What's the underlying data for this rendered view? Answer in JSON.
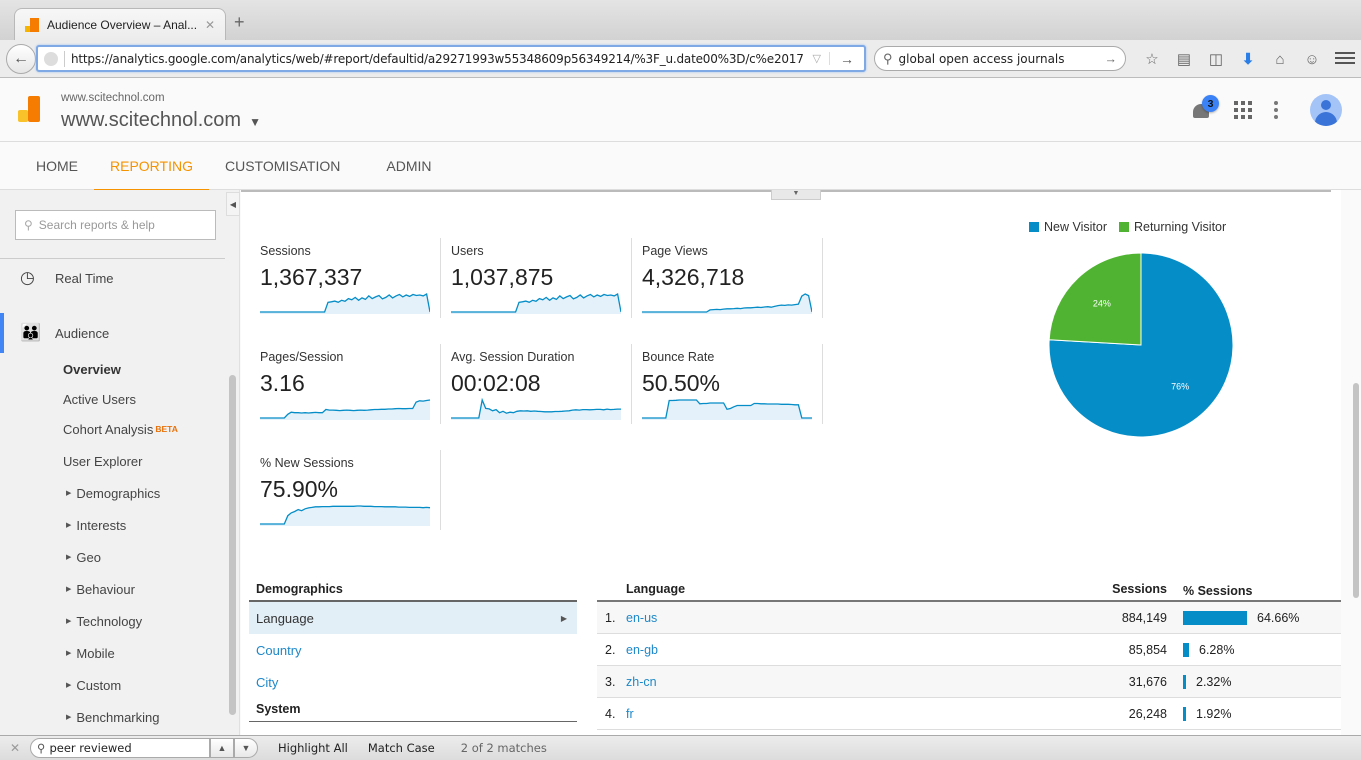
{
  "browser": {
    "tab_title": "Audience Overview – Anal...",
    "url": "https://analytics.google.com/analytics/web/#report/defaultid/a29271993w55348609p56349214/%3F_u.date00%3D/c%e2017",
    "search_value": "global open access journals",
    "toolbar_icons": [
      "bookmark-star-icon",
      "reading-list-icon",
      "pocket-icon",
      "download-icon",
      "home-icon",
      "chat-icon"
    ]
  },
  "header": {
    "account_small": "www.scitechnol.com",
    "property": "www.scitechnol.com",
    "notification_count": "3"
  },
  "nav_tabs": [
    {
      "label": "HOME",
      "active": false
    },
    {
      "label": "REPORTING",
      "active": true
    },
    {
      "label": "CUSTOMISATION",
      "active": false
    },
    {
      "label": "ADMIN",
      "active": false
    }
  ],
  "sidebar": {
    "search_placeholder": "Search reports & help",
    "sections": [
      {
        "label": "Real Time",
        "icon": "clock-icon"
      },
      {
        "label": "Audience",
        "icon": "people-icon"
      }
    ],
    "sub_items": [
      {
        "label": "Overview",
        "selected": true
      },
      {
        "label": "Active Users"
      },
      {
        "label": "Cohort Analysis",
        "badge": "BETA"
      },
      {
        "label": "User Explorer"
      },
      {
        "label": "Demographics",
        "expandable": true
      },
      {
        "label": "Interests",
        "expandable": true
      },
      {
        "label": "Geo",
        "expandable": true
      },
      {
        "label": "Behaviour",
        "expandable": true
      },
      {
        "label": "Technology",
        "expandable": true
      },
      {
        "label": "Mobile",
        "expandable": true
      },
      {
        "label": "Custom",
        "expandable": true
      },
      {
        "label": "Benchmarking",
        "expandable": true
      }
    ]
  },
  "metrics": [
    {
      "label": "Sessions",
      "value": "1,367,337",
      "trend": [
        0,
        0,
        0,
        0,
        0,
        0,
        0,
        0,
        0,
        0,
        0,
        0,
        0,
        0,
        0,
        0,
        0,
        0,
        0,
        0,
        40,
        42,
        45,
        40,
        48,
        44,
        55,
        50,
        60,
        48,
        58,
        52,
        66,
        55,
        62,
        68,
        54,
        60,
        70,
        58,
        66,
        72,
        62,
        70,
        64,
        72,
        68,
        70,
        66,
        74,
        0
      ]
    },
    {
      "label": "Users",
      "value": "1,037,875",
      "trend": [
        0,
        0,
        0,
        0,
        0,
        0,
        0,
        0,
        0,
        0,
        0,
        0,
        0,
        0,
        0,
        0,
        0,
        0,
        0,
        0,
        40,
        42,
        45,
        40,
        48,
        44,
        55,
        50,
        60,
        48,
        58,
        52,
        66,
        55,
        62,
        68,
        54,
        60,
        70,
        58,
        66,
        72,
        62,
        70,
        64,
        72,
        68,
        70,
        66,
        74,
        0
      ]
    },
    {
      "label": "Page Views",
      "value": "4,326,718",
      "trend": [
        0,
        0,
        0,
        0,
        0,
        0,
        0,
        0,
        0,
        0,
        0,
        0,
        0,
        0,
        0,
        0,
        0,
        0,
        0,
        0,
        8,
        9,
        10,
        9,
        11,
        12,
        12,
        13,
        14,
        13,
        15,
        16,
        16,
        17,
        18,
        17,
        19,
        20,
        18,
        21,
        24,
        26,
        25,
        27,
        26,
        28,
        30,
        60,
        68,
        62,
        0
      ]
    },
    {
      "label": "Pages/Session",
      "value": "3.16",
      "trend": [
        0,
        0,
        0,
        0,
        0,
        0,
        0,
        0,
        14,
        22,
        20,
        20,
        19,
        20,
        19,
        20,
        21,
        20,
        20,
        32,
        30,
        30,
        29,
        28,
        29,
        30,
        29,
        28,
        29,
        30,
        29,
        30,
        31,
        32,
        32,
        33,
        33,
        34,
        34,
        35,
        36,
        35,
        35,
        36,
        36,
        60,
        65,
        64,
        66,
        68
      ]
    },
    {
      "label": "Avg. Session Duration",
      "value": "00:02:08",
      "trend": [
        0,
        0,
        0,
        0,
        0,
        0,
        0,
        0,
        0,
        75,
        40,
        38,
        30,
        35,
        22,
        28,
        20,
        24,
        22,
        28,
        30,
        29,
        30,
        28,
        29,
        28,
        27,
        26,
        26,
        26,
        27,
        27,
        28,
        29,
        30,
        33,
        34,
        33,
        35,
        35,
        34,
        35,
        36,
        36,
        34,
        37,
        35,
        36,
        37,
        37
      ]
    },
    {
      "label": "Bounce Rate",
      "value": "50.50%",
      "trend": [
        0,
        0,
        0,
        0,
        0,
        0,
        0,
        0,
        70,
        70,
        71,
        72,
        72,
        72,
        72,
        72,
        72,
        57,
        58,
        58,
        60,
        60,
        60,
        60,
        60,
        35,
        38,
        45,
        50,
        50,
        50,
        50,
        50,
        58,
        58,
        57,
        57,
        56,
        56,
        56,
        56,
        55,
        55,
        55,
        54,
        53,
        53,
        0,
        0,
        0,
        0
      ]
    },
    {
      "label": "% New Sessions",
      "value": "75.90%",
      "trend": [
        0,
        0,
        0,
        0,
        0,
        0,
        0,
        0,
        30,
        40,
        45,
        52,
        48,
        55,
        58,
        60,
        62,
        62,
        63,
        63,
        63,
        64,
        64,
        64,
        64,
        64,
        64,
        64,
        65,
        65,
        64,
        64,
        64,
        63,
        63,
        63,
        62,
        62,
        62,
        62,
        61,
        61,
        61,
        60,
        60,
        60,
        60,
        59,
        60,
        59
      ]
    }
  ],
  "chart_data": {
    "type": "pie",
    "title": "",
    "legend_position": "top",
    "categories": [
      "New Visitor",
      "Returning Visitor"
    ],
    "values": [
      75.9,
      24.1
    ],
    "labels": [
      "76%",
      "24%"
    ],
    "colors": [
      "#058dc7",
      "#50b432"
    ]
  },
  "demographics": {
    "title": "Demographics",
    "items": [
      {
        "label": "Language",
        "selected": true
      },
      {
        "label": "Country"
      },
      {
        "label": "City"
      }
    ],
    "next_section": "System"
  },
  "language_table": {
    "headers": {
      "language": "Language",
      "sessions": "Sessions",
      "pct": "% Sessions"
    },
    "rows": [
      {
        "rank": "1.",
        "language": "en-us",
        "sessions": "884,149",
        "pct": "64.66%",
        "pct_value": 64.66
      },
      {
        "rank": "2.",
        "language": "en-gb",
        "sessions": "85,854",
        "pct": "6.28%",
        "pct_value": 6.28
      },
      {
        "rank": "3.",
        "language": "zh-cn",
        "sessions": "31,676",
        "pct": "2.32%",
        "pct_value": 2.32
      },
      {
        "rank": "4.",
        "language": "fr",
        "sessions": "26,248",
        "pct": "1.92%",
        "pct_value": 1.92
      }
    ]
  },
  "findbar": {
    "query": "peer reviewed",
    "highlight_all": "Highlight All",
    "match_case": "Match Case",
    "status": "2 of 2 matches"
  }
}
